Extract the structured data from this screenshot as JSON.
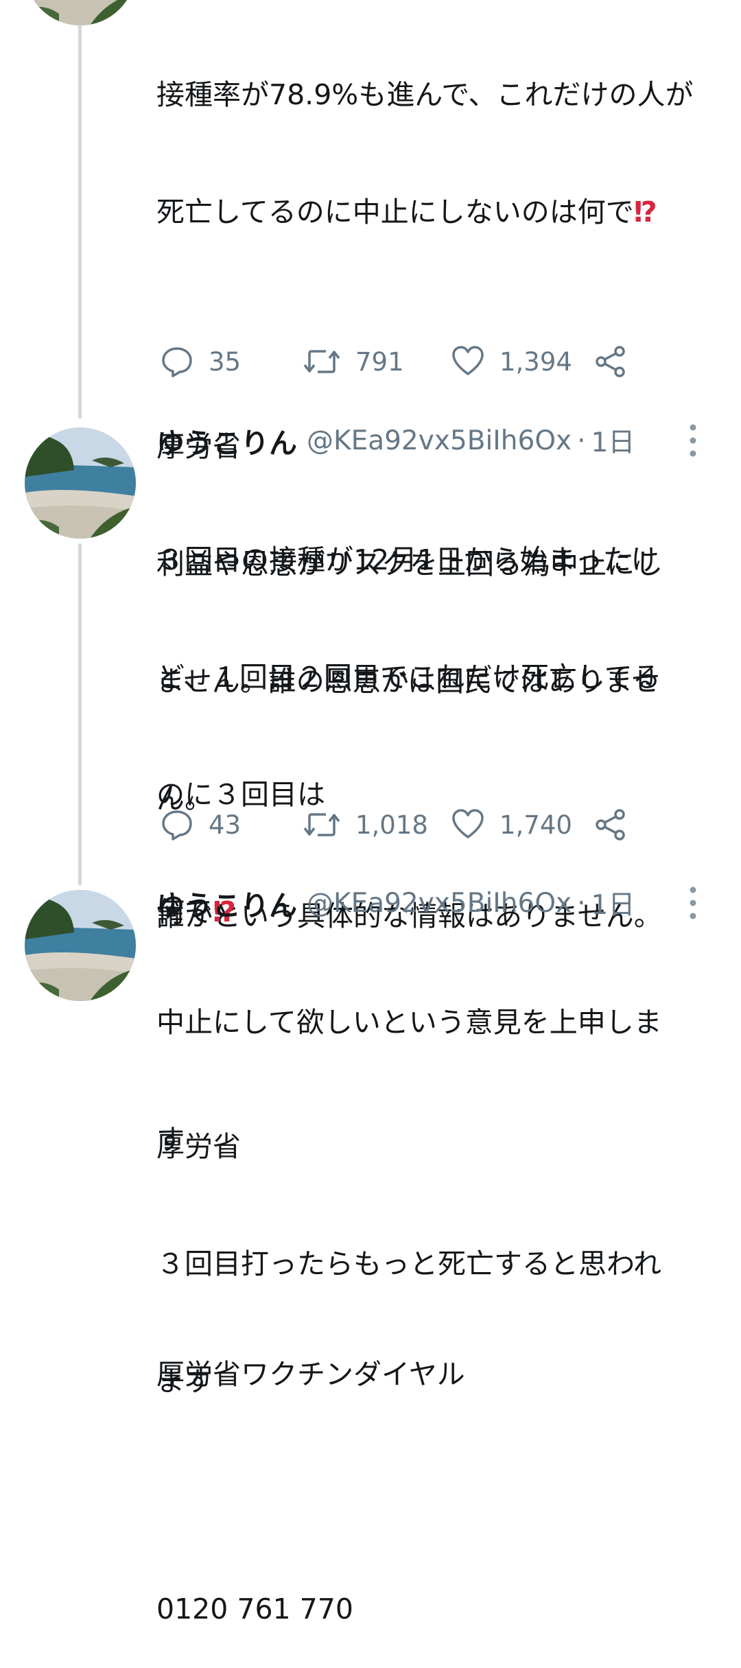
{
  "colors": {
    "text": "#14171a",
    "secondary": "#657786",
    "thread_line": "#cfd9de",
    "interrobang": "#d7263d"
  },
  "tweet1": {
    "lines": [
      "接種率が78.9%も進んで、これだけの人が",
      "死亡してるのに中止にしないのは何で",
      "",
      "厚労省",
      "利益や恩恵がリスクを上回る為中止にし",
      "ません。誰の恩恵かは国民ではありませ",
      "ん。",
      "誰かという具体的な情報はありません。"
    ],
    "interrobang": "⁉",
    "actions": {
      "reply_count": "35",
      "retweet_count": "791",
      "like_count": "1,394"
    }
  },
  "tweet2": {
    "author_name": "ゆうこりん",
    "handle": "@KEa92vx5BiIh6Ox",
    "separator": "·",
    "time": "1日",
    "avatar_icon": "beach-landscape-avatar",
    "lines": [
      "３回目の接種が12月1日から始まったけ",
      "ど、１回目２回目でこれだけ死亡してる",
      "のに３回目は",
      "何で",
      "",
      "厚労省",
      "３回目打ったらもっと死亡すると思われ",
      "ます"
    ],
    "interrobang": "⁉",
    "actions": {
      "reply_count": "43",
      "retweet_count": "1,018",
      "like_count": "1,740"
    }
  },
  "tweet3": {
    "author_name": "ゆうこりん",
    "handle": "@KEa92vx5BiIh6Ox",
    "separator": "·",
    "time": "1日",
    "avatar_icon": "beach-landscape-avatar",
    "lines": [
      "中止にして欲しいという意見を上申しま",
      "す",
      "",
      "厚労省ワクチンダイヤル",
      "",
      "0120 761 770"
    ]
  },
  "icons": {
    "reply": "reply-bubble-icon",
    "retweet": "retweet-icon",
    "like": "heart-icon",
    "share": "share-icon",
    "more": "more-vertical-icon"
  }
}
